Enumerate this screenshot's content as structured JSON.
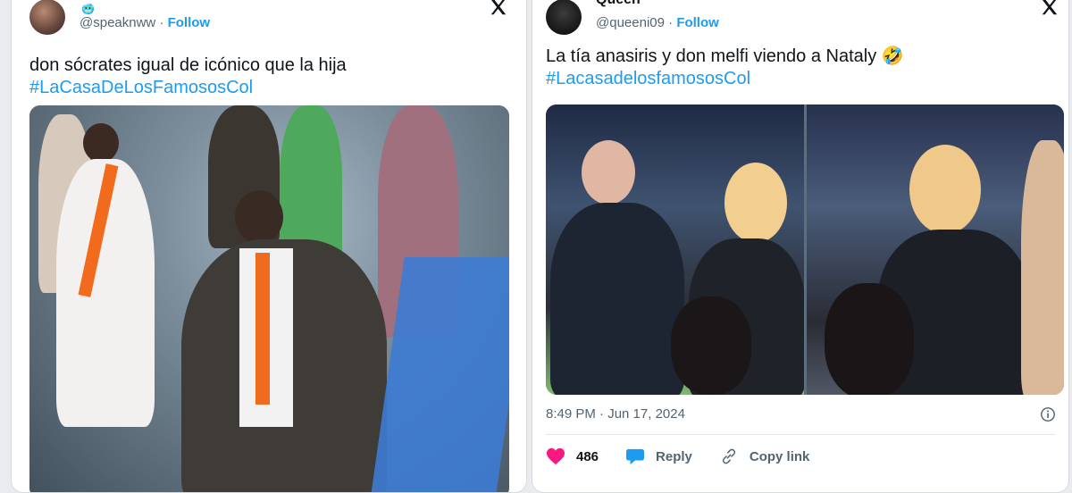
{
  "left_post": {
    "handle": "@speaknww",
    "follow_label": "Follow",
    "text": "don sócrates igual de icónico que la hija",
    "hashtag": "#LaCasaDeLosFamososCol"
  },
  "right_post": {
    "name": "Queen",
    "handle": "@queeni09",
    "follow_label": "Follow",
    "text": "La tía anasiris y don melfi viendo a Nataly 🤣",
    "hashtag": "#LacasadelosfamososCol",
    "timestamp": "8:49 PM · Jun 17, 2024",
    "like_count": "486",
    "reply_label": "Reply",
    "copy_link_label": "Copy link"
  },
  "colors": {
    "accent": "#1d9bf0",
    "like": "#f91880",
    "muted": "#536471"
  },
  "icons": [
    "x-logo-icon",
    "info-icon",
    "heart-icon",
    "reply-icon",
    "link-icon"
  ]
}
